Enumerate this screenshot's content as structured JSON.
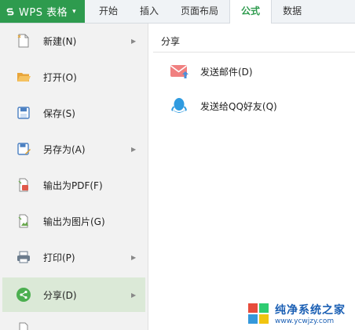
{
  "app": {
    "title": "WPS 表格",
    "dropdown_glyph": "▾"
  },
  "tabs": [
    {
      "label": "开始"
    },
    {
      "label": "插入"
    },
    {
      "label": "页面布局"
    },
    {
      "label": "公式",
      "active": true
    },
    {
      "label": "数据"
    }
  ],
  "menu": {
    "items": [
      {
        "label": "新建(N)",
        "icon": "new-file-icon",
        "has_submenu": true
      },
      {
        "label": "打开(O)",
        "icon": "folder-open-icon",
        "has_submenu": false
      },
      {
        "label": "保存(S)",
        "icon": "save-icon",
        "has_submenu": false
      },
      {
        "label": "另存为(A)",
        "icon": "save-as-icon",
        "has_submenu": true
      },
      {
        "label": "输出为PDF(F)",
        "icon": "pdf-export-icon",
        "has_submenu": false
      },
      {
        "label": "输出为图片(G)",
        "icon": "image-export-icon",
        "has_submenu": false
      },
      {
        "label": "打印(P)",
        "icon": "printer-icon",
        "has_submenu": true
      },
      {
        "label": "分享(D)",
        "icon": "share-icon",
        "has_submenu": true,
        "selected": true
      }
    ],
    "arrow_glyph": "▶"
  },
  "share_pane": {
    "title": "分享",
    "items": [
      {
        "label": "发送邮件(D)",
        "icon": "mail-icon"
      },
      {
        "label": "发送给QQ好友(Q)",
        "icon": "qq-icon"
      }
    ]
  },
  "watermark": {
    "brand": "纯净系统之家",
    "url": "www.ycwjzy.com"
  },
  "colors": {
    "accent": "#2e9b4e",
    "selected_bg": "#dbe9d7",
    "menu_bg": "#f2f2f2"
  }
}
